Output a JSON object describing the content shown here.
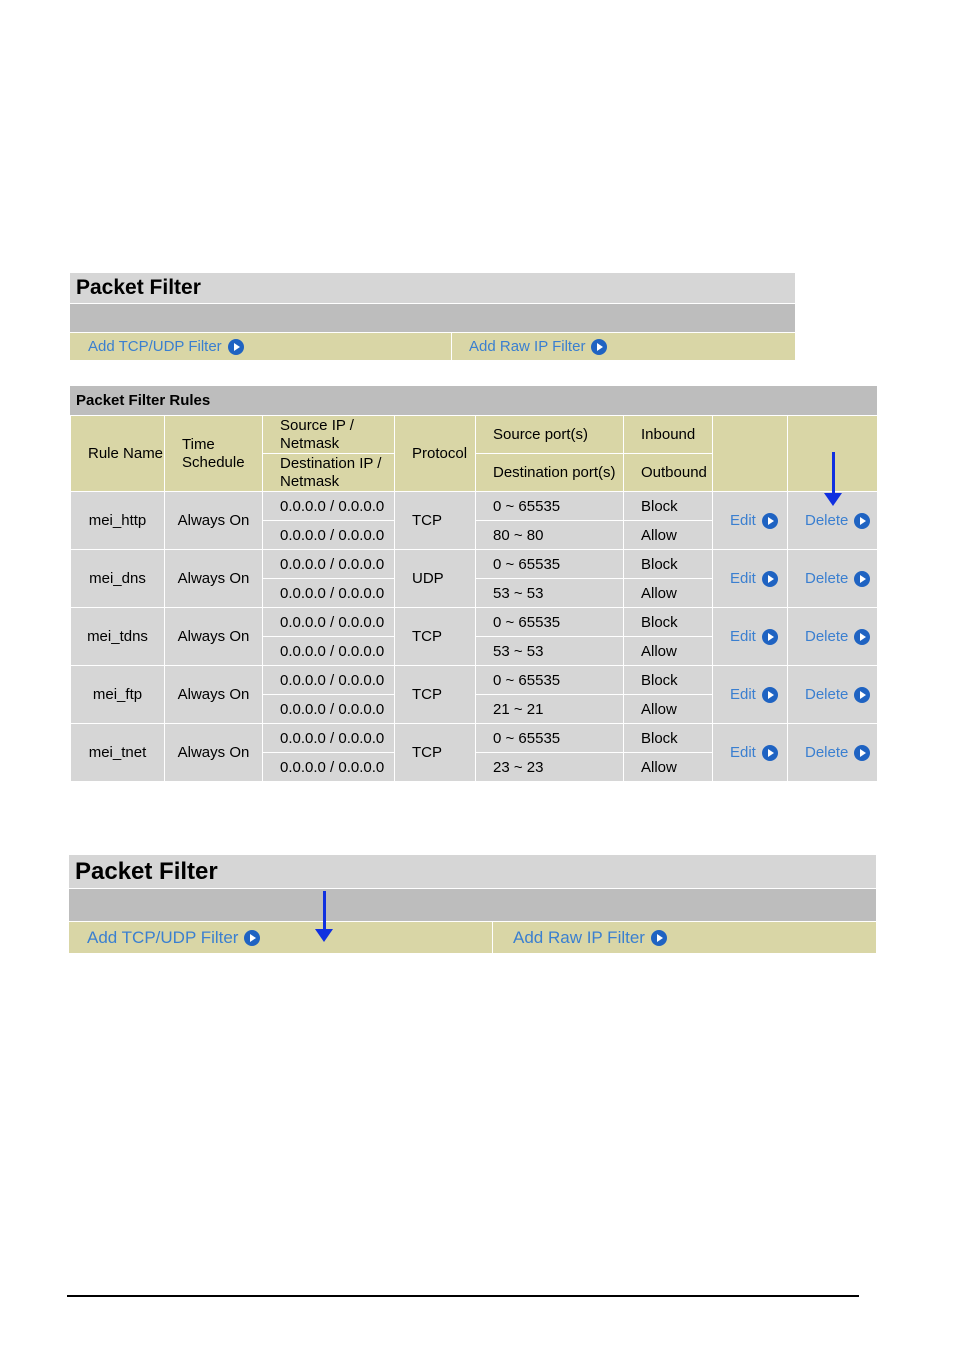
{
  "panel_top": {
    "title": "Packet Filter",
    "add_tcp_udp": "Add TCP/UDP Filter",
    "add_raw_ip": "Add Raw IP Filter"
  },
  "rules": {
    "title": "Packet Filter Rules",
    "headers": {
      "rule_name": "Rule Name",
      "time_schedule": "Time Schedule",
      "source_ip": "Source IP / Netmask",
      "destination_ip": "Destination IP / Netmask",
      "protocol": "Protocol",
      "source_ports": "Source port(s)",
      "destination_ports": "Destination port(s)",
      "inbound": "Inbound",
      "outbound": "Outbound"
    },
    "edit_label": "Edit",
    "delete_label": "Delete",
    "rows": [
      {
        "name": "mei_http",
        "schedule": "Always On",
        "src_ip": "0.0.0.0 / 0.0.0.0",
        "dst_ip": "0.0.0.0 / 0.0.0.0",
        "protocol": "TCP",
        "src_ports": "0 ~ 65535",
        "dst_ports": "80 ~ 80",
        "inbound": "Block",
        "outbound": "Allow"
      },
      {
        "name": "mei_dns",
        "schedule": "Always On",
        "src_ip": "0.0.0.0 / 0.0.0.0",
        "dst_ip": "0.0.0.0 / 0.0.0.0",
        "protocol": "UDP",
        "src_ports": "0 ~ 65535",
        "dst_ports": "53 ~ 53",
        "inbound": "Block",
        "outbound": "Allow"
      },
      {
        "name": "mei_tdns",
        "schedule": "Always On",
        "src_ip": "0.0.0.0 / 0.0.0.0",
        "dst_ip": "0.0.0.0 / 0.0.0.0",
        "protocol": "TCP",
        "src_ports": "0 ~ 65535",
        "dst_ports": "53 ~ 53",
        "inbound": "Block",
        "outbound": "Allow"
      },
      {
        "name": "mei_ftp",
        "schedule": "Always On",
        "src_ip": "0.0.0.0 / 0.0.0.0",
        "dst_ip": "0.0.0.0 / 0.0.0.0",
        "protocol": "TCP",
        "src_ports": "0 ~ 65535",
        "dst_ports": "21 ~ 21",
        "inbound": "Block",
        "outbound": "Allow"
      },
      {
        "name": "mei_tnet",
        "schedule": "Always On",
        "src_ip": "0.0.0.0 / 0.0.0.0",
        "dst_ip": "0.0.0.0 / 0.0.0.0",
        "protocol": "TCP",
        "src_ports": "0 ~ 65535",
        "dst_ports": "23 ~ 23",
        "inbound": "Block",
        "outbound": "Allow"
      }
    ]
  },
  "panel_bottom": {
    "title": "Packet Filter",
    "add_tcp_udp": "Add TCP/UDP Filter",
    "add_raw_ip": "Add Raw IP Filter"
  },
  "colors": {
    "link": "#3a7fd0",
    "link_icon": "#1f63c2",
    "header_bg": "#d9d6a6",
    "cell_bg": "#d6d6d6",
    "arrow": "#1030e0"
  }
}
